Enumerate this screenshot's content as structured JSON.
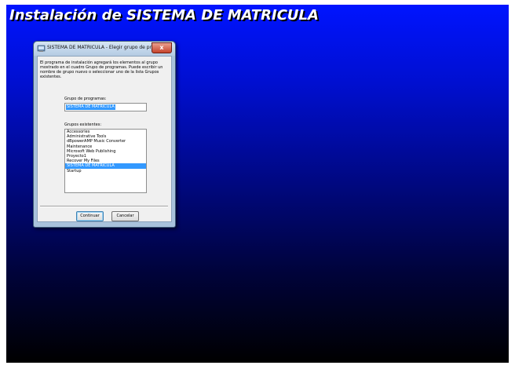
{
  "screen": {
    "title": "Instalación de SISTEMA DE MATRICULA"
  },
  "dialog": {
    "title": "SISTEMA DE MATRICULA - Elegir grupo de programas",
    "close_label": "x",
    "description": "El programa de instalación agregará los elementos al grupo mostrado en el cuadro Grupo de programas. Puede escribir un nombre de grupo nuevo o seleccionar uno de la lista Grupos existentes.",
    "program_group_label": "Grupo de programas:",
    "program_group_value": "SISTEMA DE MATRICULA",
    "existing_groups_label": "Grupos existentes:",
    "existing_groups": [
      "Accessories",
      "Administrative Tools",
      "dBpowerAMP Music Converter",
      "Maintenance",
      "Microsoft Web Publishing",
      "Proyecto1",
      "Recover My Files",
      "SISTEMA DE MATRICULA",
      "Startup"
    ],
    "selected_group": "SISTEMA DE MATRICULA",
    "continue_label": "Continuar",
    "cancel_label": "Cancelar"
  },
  "colors": {
    "background_top": "#0014ff",
    "background_bottom": "#000000",
    "selection": "#3399ff"
  },
  "icons": {
    "app": "setup-app-icon",
    "close": "close-icon"
  }
}
